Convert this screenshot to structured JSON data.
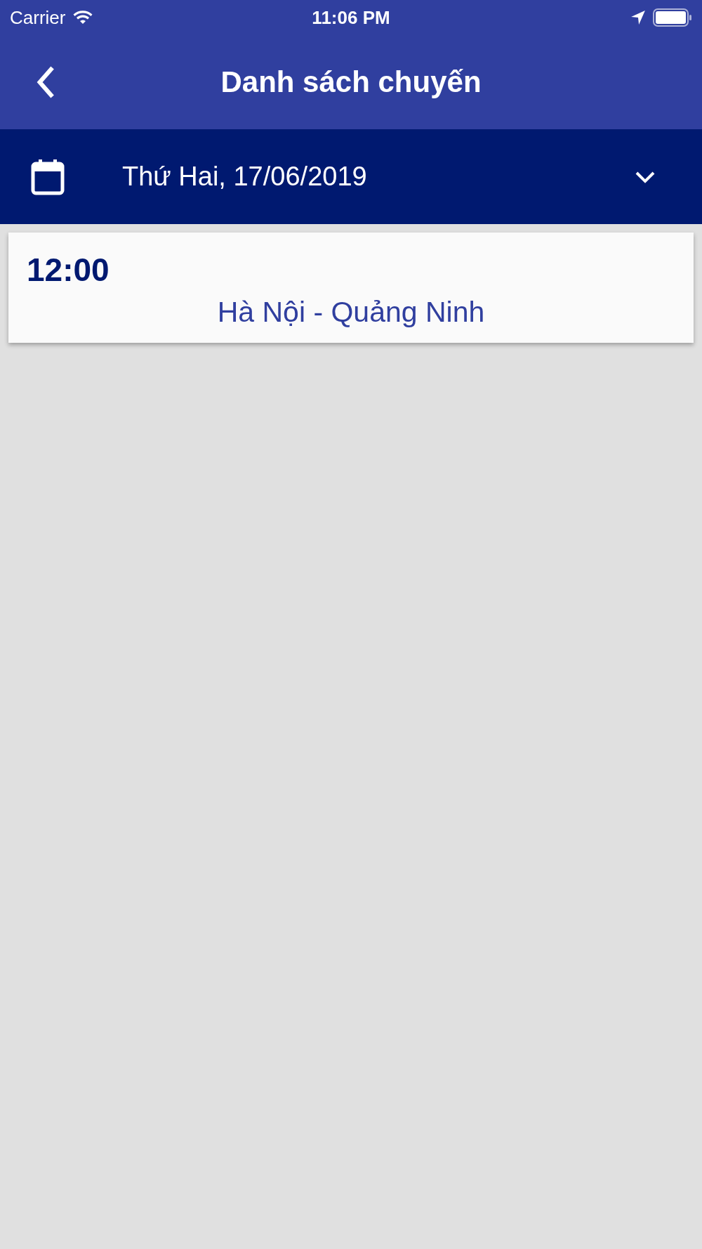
{
  "status_bar": {
    "carrier": "Carrier",
    "time": "11:06 PM"
  },
  "header": {
    "title": "Danh sách chuyến"
  },
  "date_bar": {
    "date": "Thứ Hai, 17/06/2019"
  },
  "trips": [
    {
      "time": "12:00",
      "route": "Hà Nội - Quảng Ninh"
    }
  ]
}
